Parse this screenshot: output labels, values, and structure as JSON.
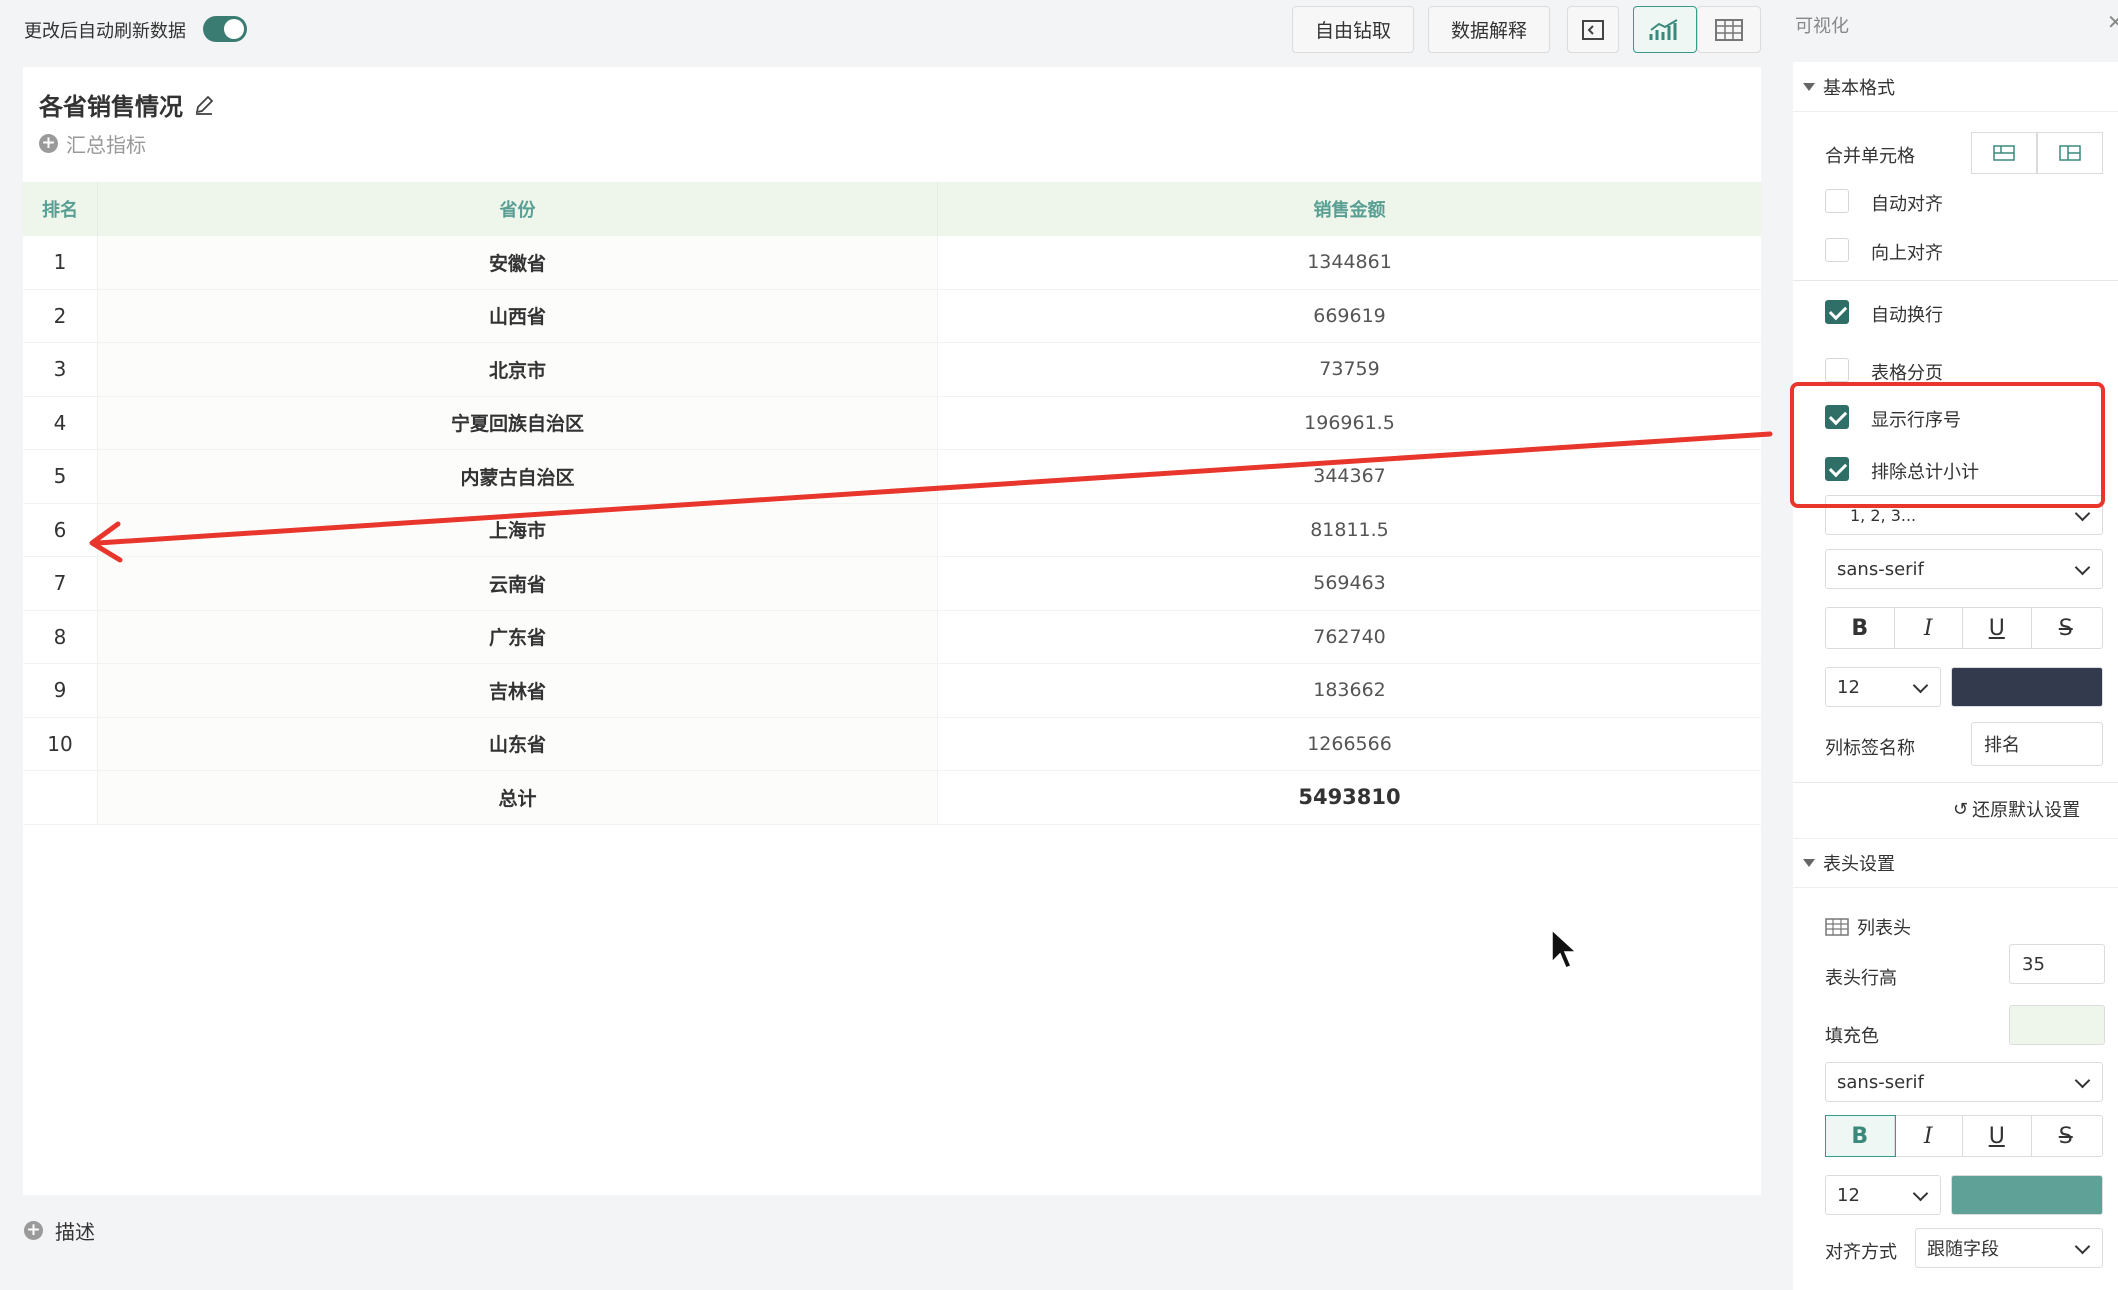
{
  "topbar": {
    "auto_refresh_label": "更改后自动刷新数据",
    "auto_refresh_on": true,
    "drill_label": "自由钻取",
    "explain_label": "数据解释"
  },
  "card": {
    "title": "各省销售情况",
    "summary_label": "汇总指标",
    "description_label": "描述"
  },
  "table": {
    "columns": [
      "排名",
      "省份",
      "销售金额"
    ],
    "rows": [
      {
        "rank": "1",
        "province": "安徽省",
        "amount": "1344861"
      },
      {
        "rank": "2",
        "province": "山西省",
        "amount": "669619"
      },
      {
        "rank": "3",
        "province": "北京市",
        "amount": "73759"
      },
      {
        "rank": "4",
        "province": "宁夏回族自治区",
        "amount": "196961.5"
      },
      {
        "rank": "5",
        "province": "内蒙古自治区",
        "amount": "344367"
      },
      {
        "rank": "6",
        "province": "上海市",
        "amount": "81811.5"
      },
      {
        "rank": "7",
        "province": "云南省",
        "amount": "569463"
      },
      {
        "rank": "8",
        "province": "广东省",
        "amount": "762740"
      },
      {
        "rank": "9",
        "province": "吉林省",
        "amount": "183662"
      },
      {
        "rank": "10",
        "province": "山东省",
        "amount": "1266566"
      }
    ],
    "total": {
      "label": "总计",
      "amount": "5493810"
    }
  },
  "panel": {
    "title": "可视化",
    "basic_format": {
      "header": "基本格式",
      "merge_cells_label": "合并单元格",
      "auto_align_label": "自动对齐",
      "auto_align": false,
      "align_up_label": "向上对齐",
      "align_up": false,
      "auto_wrap_label": "自动换行",
      "auto_wrap": true,
      "paging_label": "表格分页",
      "paging": false,
      "show_row_number_label": "显示行序号",
      "show_row_number": true,
      "exclude_subtotal_label": "排除总计小计",
      "exclude_subtotal": true,
      "number_style": "1, 2, 3...",
      "font": "sans-serif",
      "bold": "B",
      "italic": "I",
      "underline": "U",
      "strike": "S",
      "font_size": "12",
      "font_color": "#333a4d",
      "column_tag_name_label": "列标签名称",
      "column_tag_name": "排名",
      "reset_label": "还原默认设置"
    },
    "header_settings": {
      "header": "表头设置",
      "column_header_label": "列表头",
      "row_height_label": "表头行高",
      "row_height": "35",
      "fill_label": "填充色",
      "fill_color": "#eef6ec",
      "font": "sans-serif",
      "bold": "B",
      "italic": "I",
      "underline": "U",
      "strike": "S",
      "font_size": "12",
      "font_color": "#5fa097",
      "align_label": "对齐方式",
      "align_value": "跟随字段"
    }
  }
}
